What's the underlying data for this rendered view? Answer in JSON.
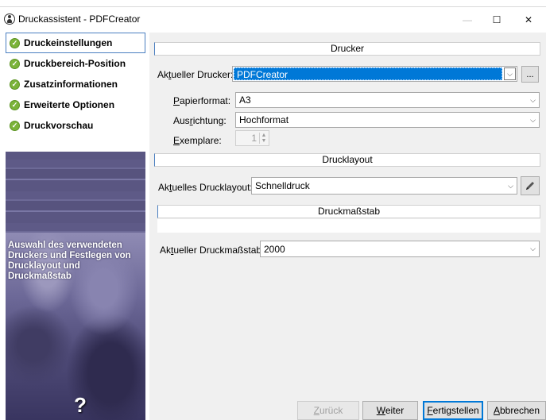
{
  "window": {
    "title": "Druckassistent - PDFCreator",
    "minimize_glyph": "—",
    "maximize_glyph": "☐",
    "close_glyph": "✕"
  },
  "sidebar": {
    "items": [
      {
        "label": "Druckeinstellungen",
        "icon": "check-circle-icon",
        "active": true
      },
      {
        "label": "Druckbereich-Position",
        "icon": "check-circle-icon",
        "active": false
      },
      {
        "label": "Zusatzinformationen",
        "icon": "check-circle-icon",
        "active": false
      },
      {
        "label": "Erweiterte Optionen",
        "icon": "check-circle-icon",
        "active": false
      },
      {
        "label": "Druckvorschau",
        "icon": "check-circle-icon",
        "active": false
      }
    ],
    "check_glyph": "✓",
    "help_text": "Auswahl des verwendeten Druckers und Festlegen von Drucklayout und Druckmaßstab",
    "help_icon": "?"
  },
  "drucker": {
    "header": "Drucker",
    "current_printer_label": "Aktueller Drucker:",
    "current_printer_value": "PDFCreator",
    "more_button": "...",
    "paper_format_label": "Papierformat:",
    "paper_format_value": "A3",
    "orientation_label": "Ausrichtung:",
    "orientation_value": "Hochformat",
    "copies_label": "Exemplare:",
    "copies_value": "1"
  },
  "drucklayout": {
    "header": "Drucklayout",
    "current_layout_label": "Aktuelles Drucklayout:",
    "current_layout_value": "Schnelldruck",
    "edit_icon": "pencil-icon"
  },
  "druckmassstab": {
    "header": "Druckmaßstab",
    "current_scale_label": "Aktueller Druckmaßstab:",
    "current_scale_value": "2000"
  },
  "buttons": {
    "back": "Zurück",
    "next": "Weiter",
    "finish": "Fertigstellen",
    "cancel": "Abbrechen"
  },
  "colors": {
    "accent": "#0078d7",
    "check": "#7bb33a",
    "panel": "#5e5a87"
  }
}
